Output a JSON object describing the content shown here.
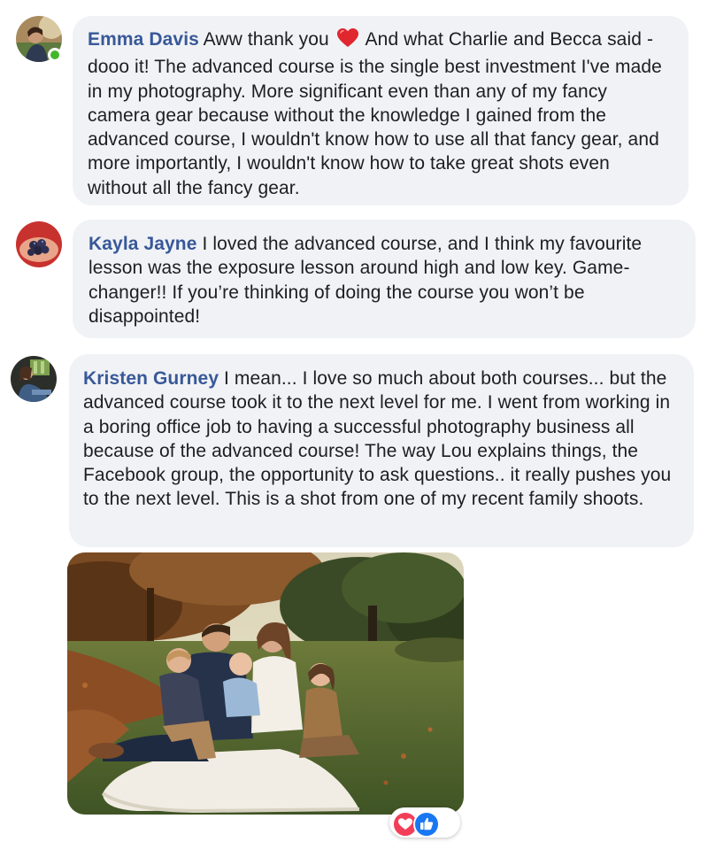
{
  "colors": {
    "bubble_bg": "#f0f2f5",
    "author_name": "#385898",
    "text": "#1c1e21",
    "online": "#42b72a",
    "love_reaction": "#f33e58",
    "like_reaction": "#1877f2"
  },
  "comments": [
    {
      "author": "Emma Davis",
      "avatar_icon": "profile-photo",
      "online": true,
      "text_before_emoji": " Aww thank you ",
      "emoji": "red-heart-emoji",
      "text_after_emoji": " And what Charlie and Becca said - dooo it! The advanced course is the single best investment I've made in my photography. More significant even than any of my fancy camera gear because without the knowledge I gained from the advanced course, I wouldn't know how to use all that fancy gear, and more importantly, I wouldn't know how to take great shots even without all the fancy gear."
    },
    {
      "author": "Kayla Jayne",
      "avatar_icon": "profile-photo",
      "online": false,
      "text": " I loved the advanced course, and I think my favourite lesson was the exposure lesson around high and low key. Game-changer!! If you’re thinking of doing the course you won’t be disappointed!"
    },
    {
      "author": "Kristen Gurney",
      "avatar_icon": "profile-photo",
      "online": false,
      "text": " I mean... I love so much about both courses... but the advanced course took it to the next level for me. I went from working in a boring office job to having a successful photography business all because of the advanced course! The way Lou explains things, the Facebook group, the opportunity to ask questions.. it really pushes you to the next level. This is a shot from one of my recent family shoots."
    }
  ],
  "attachment": {
    "type": "photo",
    "icon": "family-photo"
  },
  "reactions": [
    "love-reaction-icon",
    "like-reaction-icon"
  ]
}
